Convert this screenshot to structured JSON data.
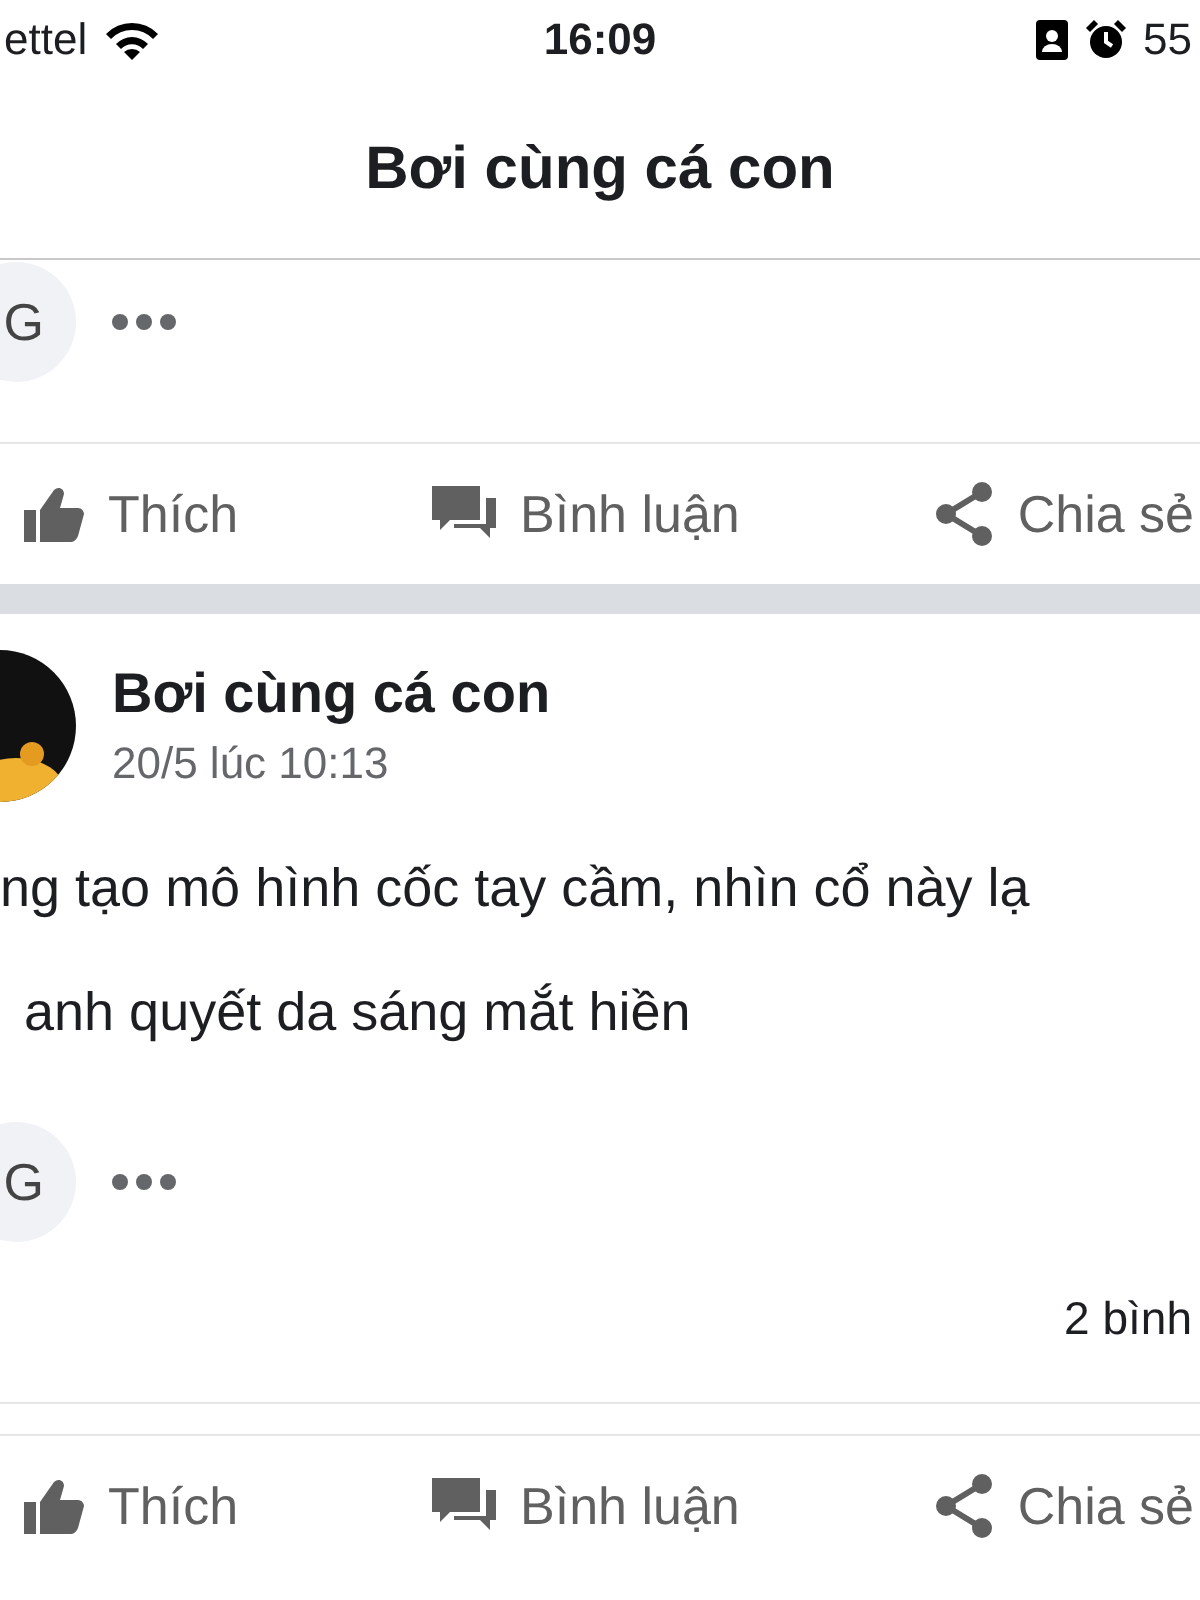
{
  "status_bar": {
    "carrier": "ettel",
    "time": "16:09",
    "battery": "55"
  },
  "header": {
    "title": "Bơi cùng cá con"
  },
  "posts": [
    {
      "kind": "partial",
      "comment_initial": "G",
      "actions": [
        {
          "kind": "like",
          "label": "Thích"
        },
        {
          "kind": "comment",
          "label": "Bình luận"
        },
        {
          "kind": "share",
          "label": "Chia sẻ"
        }
      ]
    },
    {
      "kind": "full",
      "author": "Bơi cùng cá con",
      "time": "20/5 lúc 10:13",
      "text_lines": [
        "ng tạo mô hình cốc tay cầm, nhìn cổ này lạ",
        "anh quyết da sáng mắt hiền"
      ],
      "comment_initial": "G",
      "comment_count": "2 bình",
      "actions": [
        {
          "kind": "like",
          "label": "Thích"
        },
        {
          "kind": "comment",
          "label": "Bình luận"
        },
        {
          "kind": "share",
          "label": "Chia sẻ"
        }
      ]
    }
  ]
}
